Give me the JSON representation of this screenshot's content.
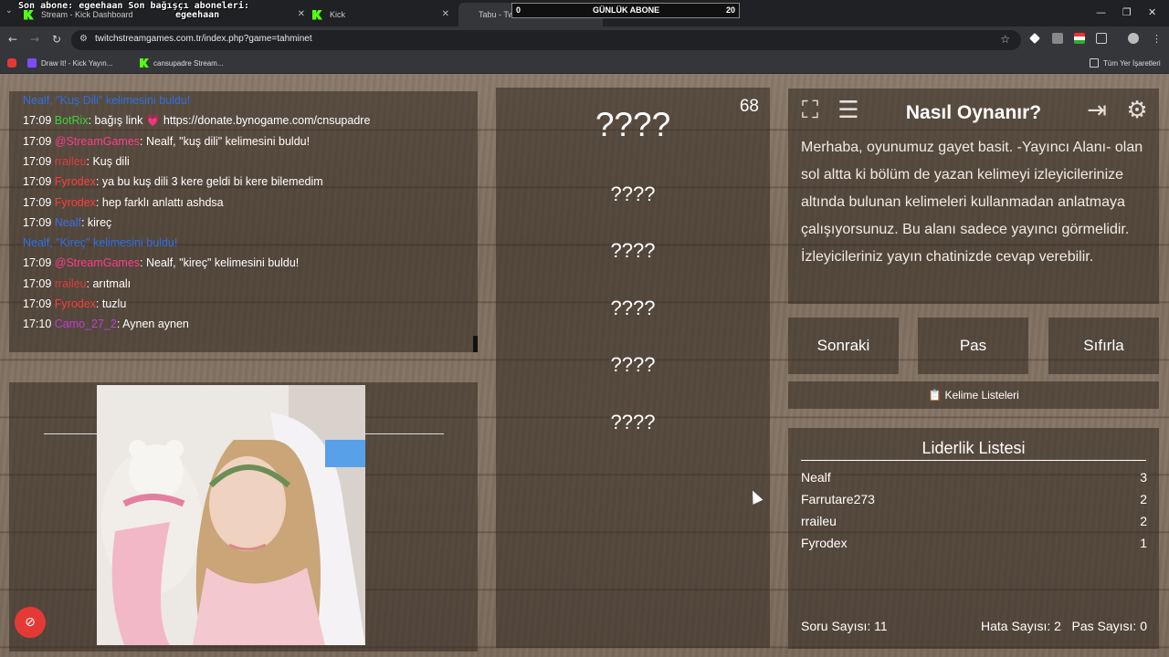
{
  "browser": {
    "overlay_line1": "Son abone: egeehaan  Son bağışçı aboneleri:",
    "overlay_line2": "egeehaan",
    "overlay_box": {
      "left": "0",
      "label": "GÜNLÜK ABONE",
      "right": "20"
    },
    "tabs": [
      {
        "title": "Stream - Kick Dashboard"
      },
      {
        "title": "Kick"
      },
      {
        "title": "Tabu - Twitch Stream Games"
      }
    ],
    "url": "twitchstreamgames.com.tr/index.php?game=tahminet",
    "bookmarks": [
      {
        "label": "Draw It! - Kick Yayın..."
      },
      {
        "label": "cansupadre Stream..."
      }
    ],
    "all_bookmarks": "Tüm Yer İşaretleri",
    "colors": {
      "chrome_dark": "#202124",
      "chrome_mid": "#35363a",
      "kick_green": "#53fc18"
    }
  },
  "chat": {
    "lines": [
      {
        "time": "",
        "user": "",
        "user_color": "#2f6fe0",
        "sep": "",
        "msg": "Nealf, \"Kuş Dili\" kelimesini buldu!",
        "msg_color": "#2f6fe0"
      },
      {
        "time": "17:09",
        "user": "BotRix",
        "user_color": "#3cd33c",
        "sep": ": ",
        "msg": "bağış link 💗 https://donate.bynogame.com/cnsupadre",
        "msg_color": "#ffffff"
      },
      {
        "time": "17:09",
        "user": "@StreamGames",
        "user_color": "#ff3c8c",
        "sep": ": ",
        "msg": "Nealf, \"kuş dili\" kelimesini buldu!",
        "msg_color": "#ffffff"
      },
      {
        "time": "17:09",
        "user": "rraileu",
        "user_color": "#e23b3b",
        "sep": ": ",
        "msg": "Kuş dili",
        "msg_color": "#ffffff"
      },
      {
        "time": "17:09",
        "user": "Fyrodex",
        "user_color": "#ff3c3c",
        "sep": ": ",
        "msg": "ya bu kuş dili 3 kere geldi bi kere bilemedim",
        "msg_color": "#ffffff"
      },
      {
        "time": "17:09",
        "user": "Fyrodex",
        "user_color": "#ff3c3c",
        "sep": ": ",
        "msg": "hep farklı anlattı ashdsa",
        "msg_color": "#ffffff"
      },
      {
        "time": "17:09",
        "user": "Nealf",
        "user_color": "#3b6fe8",
        "sep": ": ",
        "msg": "kireç",
        "msg_color": "#ffffff"
      },
      {
        "time": "",
        "user": "",
        "user_color": "#2f6fe0",
        "sep": "",
        "msg": "Nealf, \"Kireç\" kelimesini buldu!",
        "msg_color": "#2f6fe0"
      },
      {
        "time": "17:09",
        "user": "@StreamGames",
        "user_color": "#ff3c8c",
        "sep": ": ",
        "msg": "Nealf, \"kireç\" kelimesini buldu!",
        "msg_color": "#ffffff"
      },
      {
        "time": "17:09",
        "user": "rraileu",
        "user_color": "#e23b3b",
        "sep": ": ",
        "msg": "arıtmalı",
        "msg_color": "#ffffff"
      },
      {
        "time": "17:09",
        "user": "Fyrodex",
        "user_color": "#ff3c3c",
        "sep": ": ",
        "msg": "tuzlu",
        "msg_color": "#ffffff"
      },
      {
        "time": "17:10",
        "user": "Camo_27_2",
        "user_color": "#c23cd6",
        "sep": ": ",
        "msg": "Aynen aynen",
        "msg_color": "#ffffff"
      }
    ]
  },
  "words": {
    "counter": "68",
    "main": "????",
    "taboo": [
      "????",
      "????",
      "????",
      "????",
      "????"
    ]
  },
  "howto": {
    "title": "Nasıl Oynanır?",
    "text": "Merhaba, oyunumuz gayet basit. -Yayıncı Alanı- olan sol altta ki bölüm de yazan kelimeyi izleyicilerinize altında bulunan kelimeleri kullanmadan anlatmaya çalışıyorsunuz. Bu alanı sadece yayıncı görmelidir. İzleyicileriniz yayın chatinizde cevap verebilir."
  },
  "controls": {
    "next": "Sonraki",
    "pass": "Pas",
    "reset": "Sıfırla",
    "word_lists": "Kelime Listeleri"
  },
  "leaderboard": {
    "title": "Liderlik Listesi",
    "rows": [
      {
        "name": "Nealf",
        "score": "3"
      },
      {
        "name": "Farrutare273",
        "score": "2"
      },
      {
        "name": "rraileu",
        "score": "2"
      },
      {
        "name": "Fyrodex",
        "score": "1"
      }
    ],
    "questions": "Soru Sayısı: 11",
    "errors": "Hata Sayısı: 2",
    "passes": "Pas Sayısı: 0"
  }
}
